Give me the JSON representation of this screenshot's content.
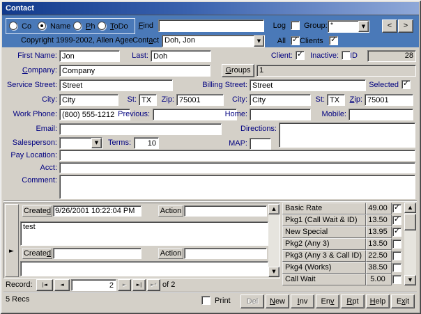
{
  "colors": {
    "window_gray": "#d4d0c8",
    "header_blue": "#4a79b8",
    "titlebar_left": "#123a8c",
    "titlebar_right": "#8fa8d8",
    "label_navy": "#000080"
  },
  "window": {
    "title": "Contact"
  },
  "header": {
    "radio_options": [
      {
        "label": "Co",
        "selected": false
      },
      {
        "label": "Name",
        "selected": true
      },
      {
        "label": "Ph",
        "selected": false
      },
      {
        "label": "ToDo",
        "selected": false
      }
    ],
    "copyright": "Copyright 1999-2002, Allen Agee",
    "find_label": "Find",
    "find_value": "",
    "contact_label": "Contact",
    "contact_value": "Doh, Jon",
    "log_label": "Log",
    "log_checked": false,
    "group_label": "Group:",
    "group_value": "*",
    "prev_button": "<",
    "next_button": ">",
    "all_label": "All",
    "all_checked": true,
    "clients_label": "Clients",
    "clients_checked": true
  },
  "form": {
    "first_name_label": "First Name:",
    "first_name": "Jon",
    "last_label": "Last:",
    "last_name": "Doh",
    "client_label": "Client:",
    "client_checked": true,
    "inactive_label": "Inactive:",
    "inactive_checked": false,
    "id_label": "ID",
    "id_value": "28",
    "company_label": "Company:",
    "company": "Company",
    "groups_button": "Groups",
    "groups_value": "1",
    "service_street_label": "Service Street:",
    "service_street": "Street",
    "billing_street_label": "Billing Street:",
    "billing_street": "Street",
    "selected_label": "Selected",
    "selected_checked": true,
    "service_city_label": "City:",
    "service_city": "City",
    "service_st_label": "St:",
    "service_st": "TX",
    "service_zip_label": "Zip:",
    "service_zip": "75001",
    "billing_city_label": "City:",
    "billing_city": "City",
    "billing_st_label": "St:",
    "billing_st": "TX",
    "billing_zip_label": "Zip:",
    "billing_zip": "75001",
    "work_phone_label": "Work Phone:",
    "work_phone": "(800) 555-1212",
    "previous_label": "Previous:",
    "previous": "",
    "home_label": "Home:",
    "home": "",
    "mobile_label": "Mobile:",
    "mobile": "",
    "email_label": "Email:",
    "email": "",
    "directions_label": "Directions:",
    "directions": "",
    "salesperson_label": "Salesperson:",
    "salesperson": "",
    "terms_label": "Terms:",
    "terms": "10",
    "map_label": "MAP:",
    "map": "",
    "pay_location_label": "Pay Location:",
    "pay_location": "",
    "acct_label": "Acct:",
    "acct": "",
    "comment_label": "Comment:",
    "comment": ""
  },
  "notes": {
    "records": [
      {
        "created_label": "Created",
        "created": "9/26/2001 10:22:04 PM",
        "action_label": "Action",
        "action": "",
        "note": "test",
        "current": false
      },
      {
        "created_label": "Created",
        "created": "",
        "action_label": "Action",
        "action": "",
        "note": "",
        "current": true
      }
    ],
    "nav": {
      "label": "Record:",
      "first": "|◄",
      "prev": "◄",
      "next": "►",
      "last": "►|",
      "new_rec": "►*",
      "value": "2",
      "of_label": "of 2",
      "next_disabled": true,
      "new_disabled": true
    }
  },
  "rates": {
    "items": [
      {
        "name": "Basic Rate",
        "price": "49.00",
        "checked": true
      },
      {
        "name": "Pkg1 (Call Wait & ID)",
        "price": "13.50",
        "checked": true
      },
      {
        "name": "New Special",
        "price": "13.95",
        "checked": true
      },
      {
        "name": "Pkg2 (Any 3)",
        "price": "13.50",
        "checked": false
      },
      {
        "name": "Pkg3 (Any 3 & Call ID)",
        "price": "22.50",
        "checked": false
      },
      {
        "name": "Pkg4 (Works)",
        "price": "38.50",
        "checked": false
      },
      {
        "name": "Call Wait",
        "price": "5.00",
        "checked": false
      }
    ]
  },
  "footer": {
    "recs_count": "5 Recs",
    "print_label": "Print",
    "print_checked": false,
    "buttons": [
      {
        "label": "Del",
        "disabled": true
      },
      {
        "label": "New",
        "disabled": false
      },
      {
        "label": "Inv",
        "disabled": false
      },
      {
        "label": "Env",
        "disabled": false
      },
      {
        "label": "Rpt",
        "disabled": false
      },
      {
        "label": "Help",
        "disabled": false
      },
      {
        "label": "Exit",
        "disabled": false
      }
    ]
  }
}
